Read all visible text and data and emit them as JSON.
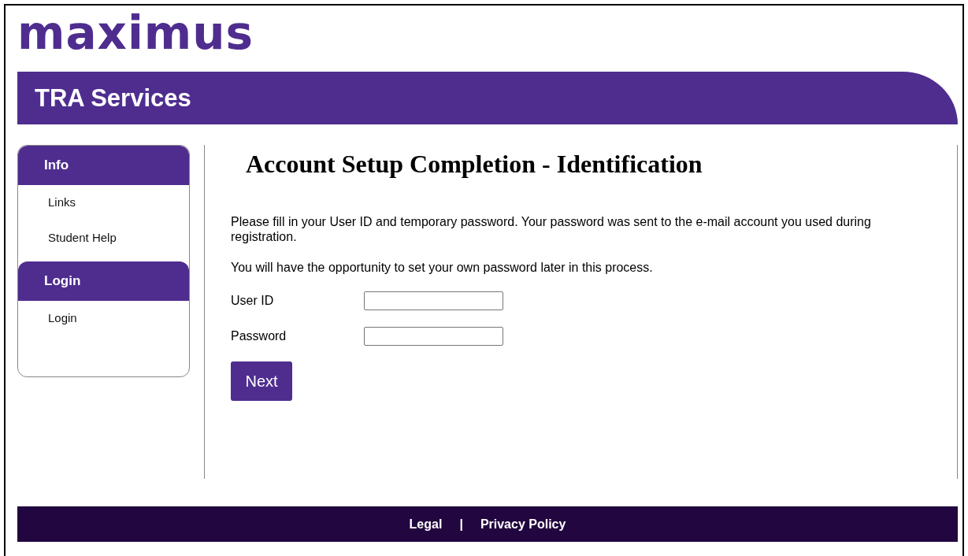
{
  "logo": "maximus",
  "header": {
    "title": "TRA Services"
  },
  "sidebar": [
    {
      "heading": "Info",
      "items": [
        "Links",
        "Student Help"
      ]
    },
    {
      "heading": "Login",
      "items": [
        "Login"
      ]
    }
  ],
  "main": {
    "title": "Account Setup Completion - Identification",
    "paragraphs": [
      "Please fill in your User ID and temporary password. Your password was sent to the e-mail account you used during registration.",
      "You will have the opportunity to set your own password later in this process."
    ],
    "fields": [
      {
        "label": "User ID"
      },
      {
        "label": "Password"
      }
    ],
    "button": "Next"
  },
  "footer": {
    "links": [
      "Legal",
      "Privacy Policy"
    ],
    "separator": "|"
  }
}
